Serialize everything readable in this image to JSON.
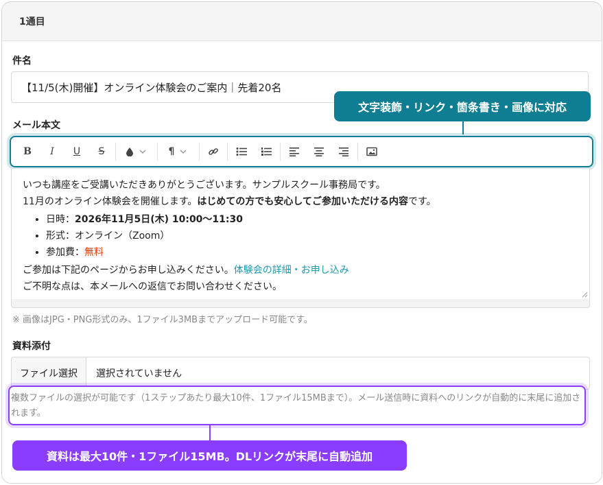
{
  "section_title": "1通目",
  "subject": {
    "label": "件名",
    "value": "【11/5(木)開催】オンライン体験会のご案内｜先着20名"
  },
  "body": {
    "label": "メール本文",
    "toolbar": {
      "bold": "B",
      "italic": "I",
      "underline": "U",
      "strike": "S",
      "color_icon": "droplet-icon",
      "paragraph": "¶",
      "link_icon": "link-icon",
      "bullet_icon": "bullet-list-icon",
      "number_icon": "numbered-list-icon",
      "align_left_icon": "align-left-icon",
      "align_center_icon": "align-center-icon",
      "align_right_icon": "align-right-icon",
      "image_icon": "image-icon"
    },
    "line1": "いつも講座をご受講いただきありがとうございます。サンプルスクール事務局です。",
    "line2_plain": "11月のオンライン体験会を開催します。",
    "line2_bold": "はじめての方でも安心してご参加いただける内容",
    "line2_end": "です。",
    "list": {
      "date_label": "日時：",
      "date_value": "2026年11月5日(木) 10:00〜11:30",
      "format_label": "形式：",
      "format_value": "オンライン（Zoom）",
      "fee_label": "参加費：",
      "fee_value": "無料"
    },
    "line3_plain": "ご参加は下記のページからお申し込みください。",
    "line3_link": "体験会の詳細・お申し込み",
    "line4": "ご不明な点は、本メールへの返信でお問い合わせください。"
  },
  "image_note": "※ 画像はJPG・PNG形式のみ、1ファイル3MBまでアップロード可能です。",
  "attachment": {
    "label": "資料添付",
    "button": "ファイル選択",
    "status": "選択されていません",
    "note": "複数ファイルの選択が可能です（1ステップあたり最大10件、1ファイル15MBまで）。メール送信時に資料へのリンクが自動的に末尾に追加されます。"
  },
  "callouts": {
    "toolbar": "文字装飾・リンク・箇条書き・画像に対応",
    "attachment": "資料は最大10件・1ファイル15MB。DLリンクが末尾に自動追加"
  },
  "colors": {
    "teal": "#0f7e92",
    "purple": "#8a3cff",
    "free_red": "#d9400c",
    "link": "#1c9ab1"
  }
}
